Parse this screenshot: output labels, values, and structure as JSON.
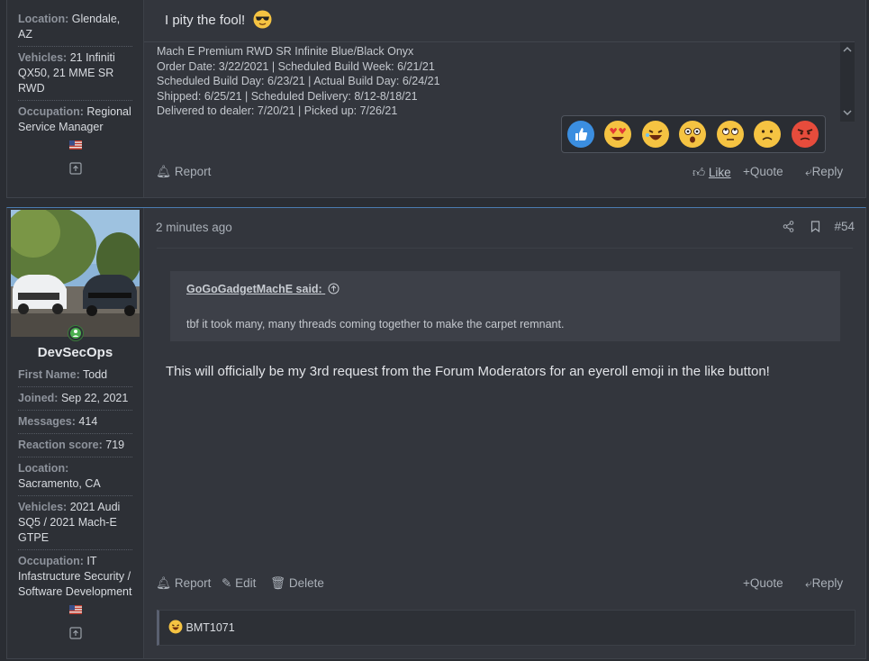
{
  "post1": {
    "user_fields": [
      {
        "label": "Location:",
        "value": "Glendale, AZ"
      },
      {
        "label": "Vehicles:",
        "value": "21 Infiniti QX50, 21 MME SR RWD"
      },
      {
        "label": "Occupation:",
        "value": "Regional Service Manager"
      }
    ],
    "message": "I pity the fool!",
    "signature": [
      "Mach E Premium RWD SR Infinite Blue/Black Onyx",
      "Order Date: 3/22/2021 | Scheduled Build Week: 6/21/21",
      "Scheduled Build Day: 6/23/21 | Actual Build Day: 6/24/21",
      "Shipped: 6/25/21 | Scheduled Delivery: 8/12-8/18/21",
      "Delivered to dealer: 7/20/21 | Picked up: 7/26/21"
    ],
    "reactions": [
      "like",
      "love",
      "haha",
      "wow",
      "eyeroll",
      "sad",
      "angry"
    ],
    "actions": {
      "report": "Report",
      "like": "Like",
      "quote": "Quote",
      "reply": "Reply"
    }
  },
  "post2": {
    "username": "DevSecOps",
    "user_fields": [
      {
        "label": "First Name:",
        "value": "Todd"
      },
      {
        "label": "Joined:",
        "value": "Sep 22, 2021"
      },
      {
        "label": "Messages:",
        "value": "414"
      },
      {
        "label": "Reaction score:",
        "value": "719"
      },
      {
        "label": "Location:",
        "value": "Sacramento, CA"
      },
      {
        "label": "Vehicles:",
        "value": "2021 Audi SQ5 / 2021 Mach-E GTPE"
      },
      {
        "label": "Occupation:",
        "value": "IT Infastructure Security / Software Development"
      }
    ],
    "timestamp": "2 minutes ago",
    "post_number": "#54",
    "quote": {
      "author": "GoGoGadgetMachE said:",
      "text": "tbf it took many, many threads coming together to make the carpet remnant."
    },
    "message": "This will officially be my 3rd request from the Forum Moderators for an eyeroll emoji in the like button!",
    "actions": {
      "report": "Report",
      "edit": "Edit",
      "delete": "Delete",
      "quote": "Quote",
      "reply": "Reply"
    },
    "reacted_by": "BMT1071"
  },
  "colors": {
    "background": "#2a2d33",
    "post_bg": "#33363d",
    "sidebar_bg": "#2d3036",
    "accent_border": "#4a7bb0"
  }
}
